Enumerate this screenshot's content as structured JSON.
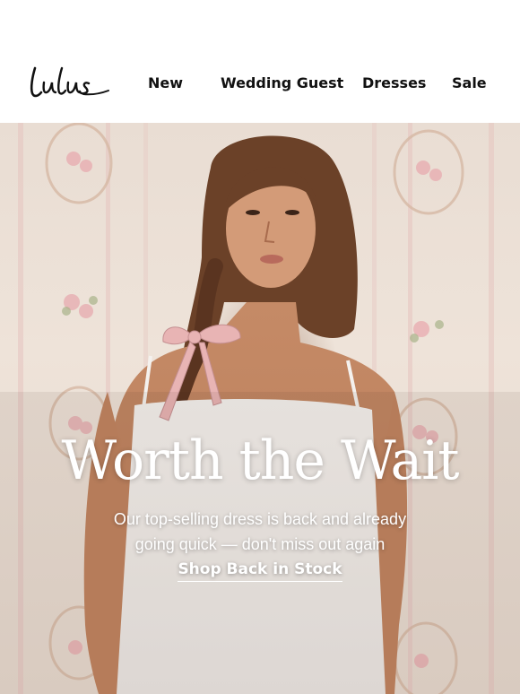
{
  "header": {
    "logo_text": "Lulus",
    "nav": [
      {
        "label": "New"
      },
      {
        "label": "Wedding Guest"
      },
      {
        "label": "Dresses"
      },
      {
        "label": "Sale"
      }
    ]
  },
  "hero": {
    "image_icon": "model-photo",
    "title": "Worth the Wait",
    "subtitle_line1": "Our top-selling dress is back and already",
    "subtitle_line2": "going quick — don't miss out again",
    "cta_label": "Shop Back in Stock"
  },
  "colors": {
    "background": "#ffffff",
    "nav_text": "#111111",
    "hero_text": "#ffffff",
    "bow_pink": "#e8b4b4",
    "wallpaper": "#ece0d6"
  }
}
